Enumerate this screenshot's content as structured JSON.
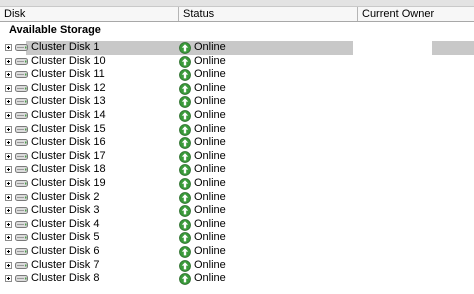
{
  "columns": {
    "disk": "Disk",
    "status": "Status",
    "owner": "Current Owner"
  },
  "group": {
    "title": "Available Storage"
  },
  "icons": {
    "expander": "expand-plus-icon",
    "disk": "disk-drive-icon",
    "status": "online-up-arrow-icon"
  },
  "colors": {
    "status_online": "#3a9a3a",
    "selection": "#c8c8c8"
  },
  "disks": [
    {
      "name": "Cluster Disk 1",
      "status": "Online",
      "selected": true
    },
    {
      "name": "Cluster Disk 10",
      "status": "Online"
    },
    {
      "name": "Cluster Disk 11",
      "status": "Online"
    },
    {
      "name": "Cluster Disk 12",
      "status": "Online"
    },
    {
      "name": "Cluster Disk 13",
      "status": "Online"
    },
    {
      "name": "Cluster Disk 14",
      "status": "Online"
    },
    {
      "name": "Cluster Disk 15",
      "status": "Online"
    },
    {
      "name": "Cluster Disk 16",
      "status": "Online"
    },
    {
      "name": "Cluster Disk 17",
      "status": "Online"
    },
    {
      "name": "Cluster Disk 18",
      "status": "Online"
    },
    {
      "name": "Cluster Disk 19",
      "status": "Online"
    },
    {
      "name": "Cluster Disk 2",
      "status": "Online"
    },
    {
      "name": "Cluster Disk 3",
      "status": "Online"
    },
    {
      "name": "Cluster Disk 4",
      "status": "Online"
    },
    {
      "name": "Cluster Disk 5",
      "status": "Online"
    },
    {
      "name": "Cluster Disk 6",
      "status": "Online"
    },
    {
      "name": "Cluster Disk 7",
      "status": "Online"
    },
    {
      "name": "Cluster Disk 8",
      "status": "Online"
    }
  ]
}
